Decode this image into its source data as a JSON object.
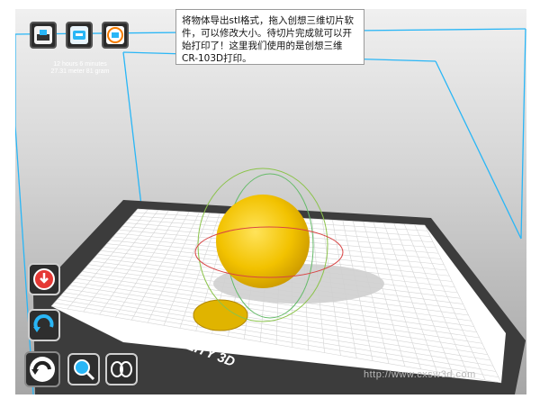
{
  "toolbar": {
    "items": [
      {
        "name": "print-button",
        "icon": "printer-icon"
      },
      {
        "name": "storage-button",
        "icon": "storage-icon"
      },
      {
        "name": "brand-button",
        "icon": "creality-logo-icon"
      }
    ],
    "print_time": "12 hours 6 minutes",
    "print_material": "27.31 meter 81 gram"
  },
  "annotation": {
    "text": "将物体导出stl格式，拖入创想三维切片软件，可以修改大小。待切片完成就可以开始打印了！这里我们使用的是创想三维CR-103D打印。"
  },
  "build_plate": {
    "brand_label": "CREALITY 3D",
    "plate_color": "#ffffff",
    "border_color": "#3c3c3c"
  },
  "model": {
    "shape": "sphere",
    "color": "#f2c200"
  },
  "side_tools": [
    {
      "name": "load-button",
      "icon": "download-icon"
    },
    {
      "name": "rotate-view-button",
      "icon": "rotate-view-icon"
    },
    {
      "name": "rotate-tool-button",
      "icon": "rotate-icon"
    },
    {
      "name": "scale-tool-button",
      "icon": "scale-icon"
    },
    {
      "name": "mirror-tool-button",
      "icon": "mirror-icon"
    }
  ],
  "watermark": "http://www.cxsw3d.com",
  "colors": {
    "accent_blue": "#29b6f6",
    "toolbar_dark": "#2b2b2b",
    "model_yellow": "#f2c200",
    "load_red": "#e53935"
  }
}
